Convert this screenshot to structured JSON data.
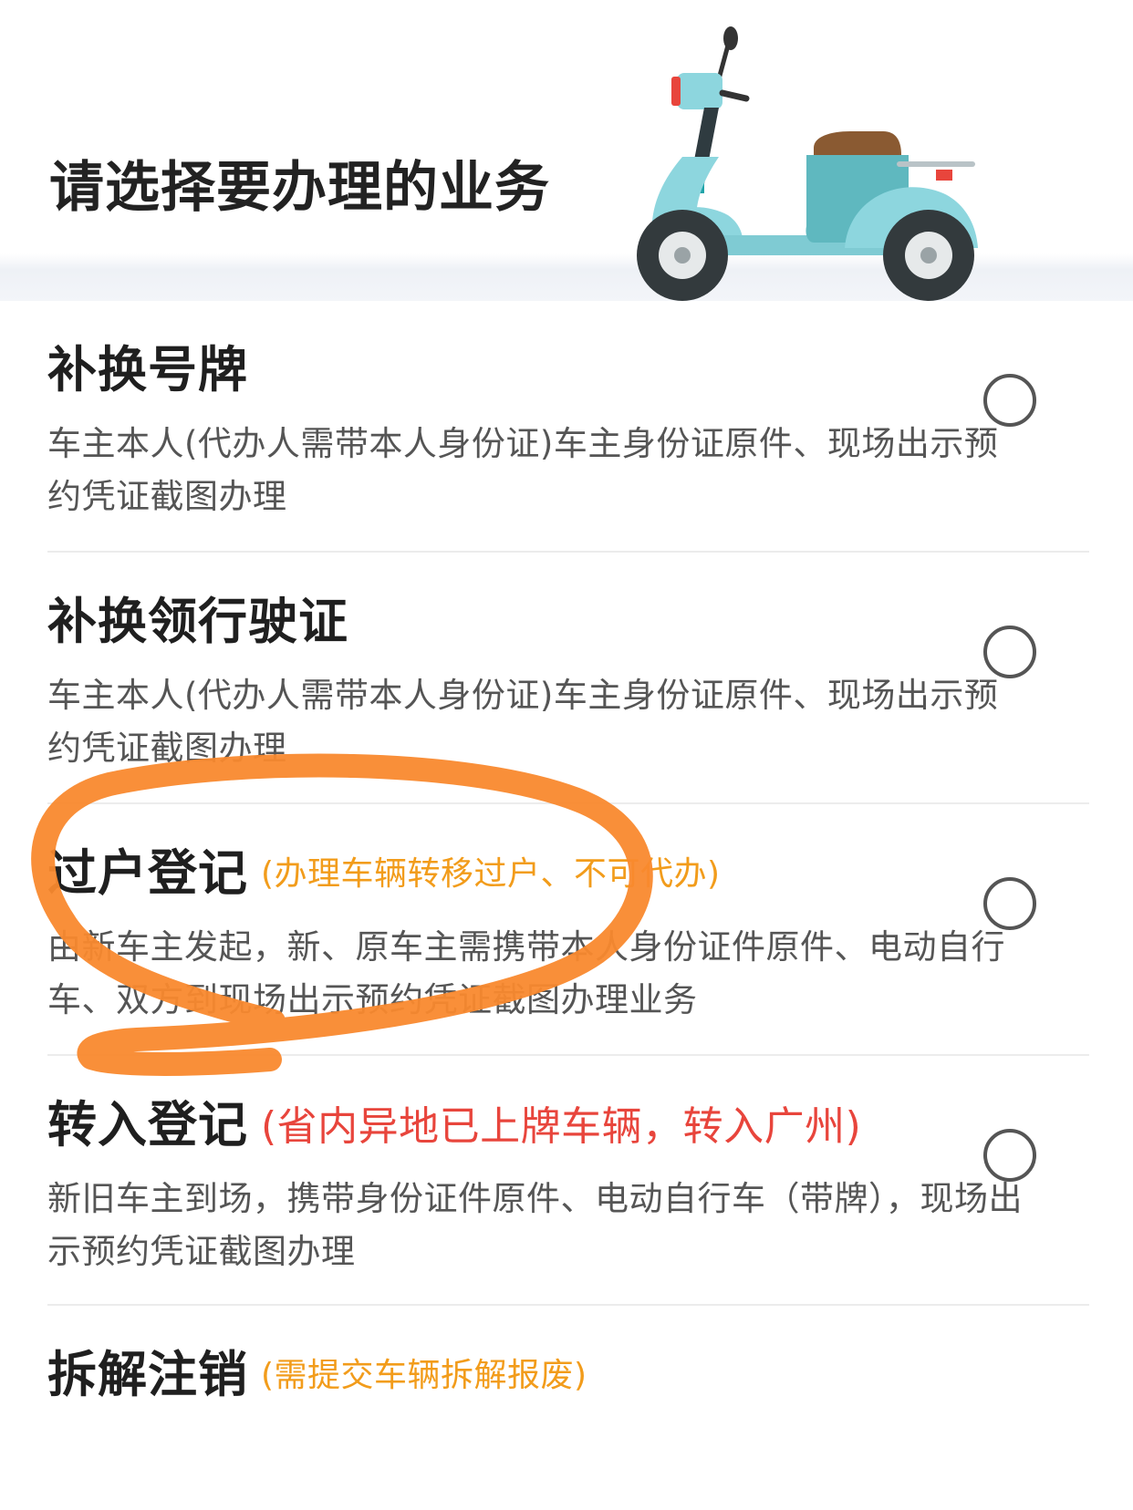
{
  "header": {
    "title": "请选择要办理的业务"
  },
  "icons": {
    "illustration": "scooter-icon",
    "option": "radio-circle-icon"
  },
  "colors": {
    "note_orange": "#f29c1b",
    "note_red": "#e8453c",
    "annotation_stroke": "#f9892e"
  },
  "services": [
    {
      "title": "补换号牌",
      "note": "",
      "description": "车主本人(代办人需带本人身份证)车主身份证原件、现场出示预约凭证截图办理",
      "selected": false
    },
    {
      "title": "补换领行驶证",
      "note": "",
      "description": "车主本人(代办人需带本人身份证)车主身份证原件、现场出示预约凭证截图办理",
      "selected": false
    },
    {
      "title": "过户登记",
      "note": "(办理车辆转移过户、不可代办)",
      "description": "由新车主发起，新、原车主需携带本人身份证件原件、电动自行车、双方到现场出示预约凭证截图办理业务",
      "selected": false
    },
    {
      "title": "转入登记",
      "note": "(省内异地已上牌车辆，转入广州)",
      "description": "新旧车主到场，携带身份证件原件、电动自行车（带牌），现场出示预约凭证截图办理",
      "selected": false
    },
    {
      "title": "拆解注销",
      "note": "(需提交车辆拆解报废)",
      "description": "",
      "selected": false
    }
  ]
}
